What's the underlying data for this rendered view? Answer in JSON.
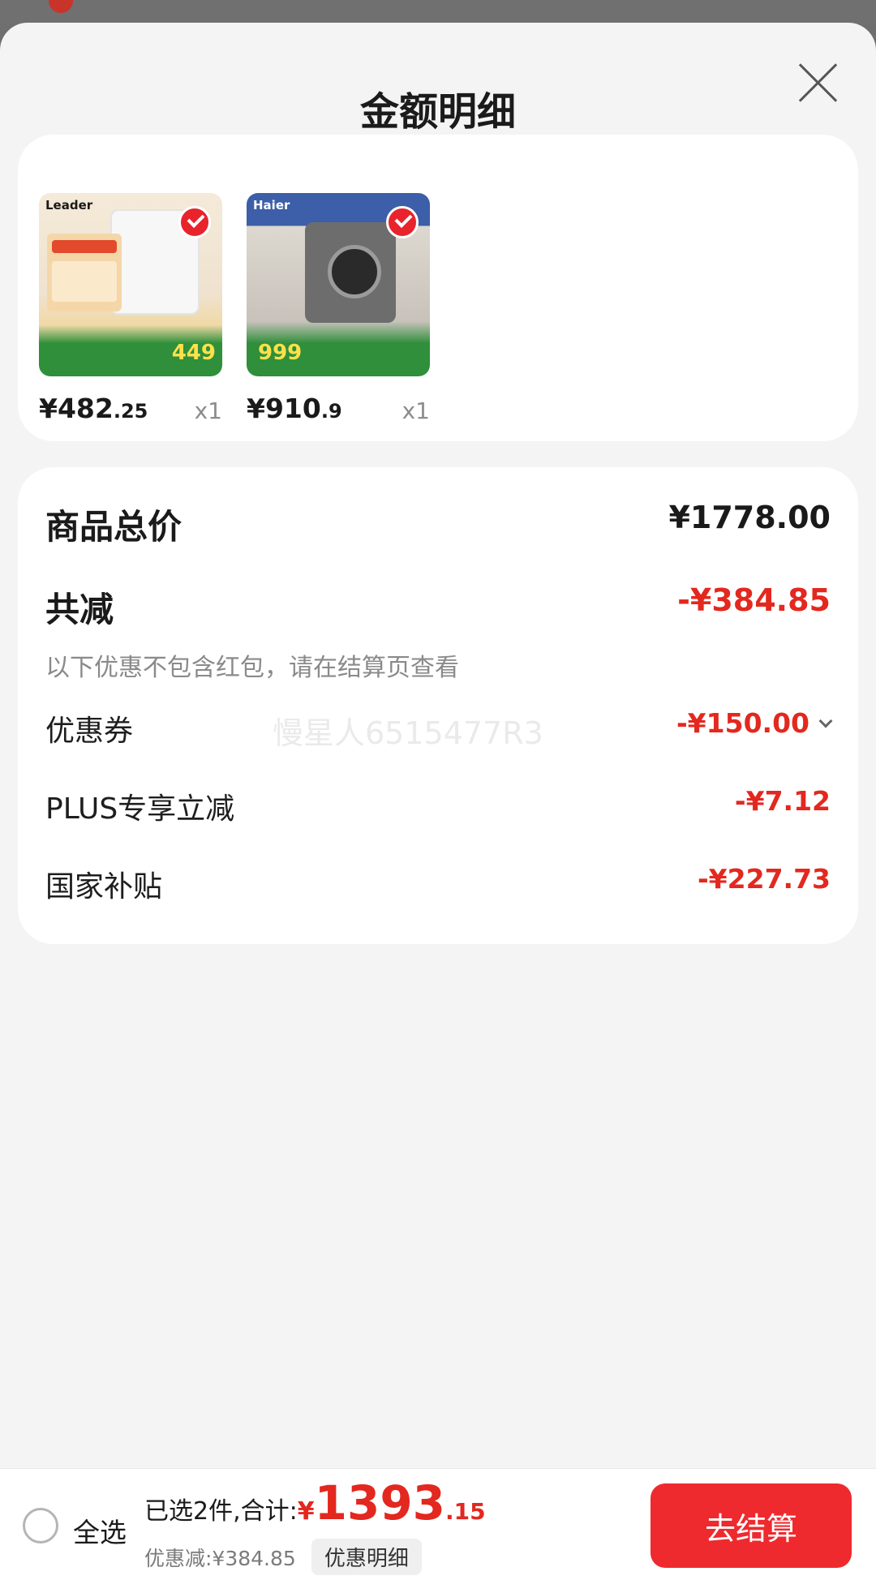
{
  "sheet": {
    "title": "金额明细"
  },
  "products": [
    {
      "brand": "Leader",
      "thumb_price": "449",
      "price_int": "¥482",
      "price_frac": ".25",
      "qty": "x1"
    },
    {
      "brand": "Haier",
      "thumb_price": "999",
      "price_int": "¥910",
      "price_frac": ".9",
      "qty": "x1"
    }
  ],
  "summary": {
    "total_label": "商品总价",
    "total_value": "¥1778.00",
    "reduce_label": "共减",
    "reduce_value": "-¥384.85",
    "note": "以下优惠不包含红包，请在结算页查看",
    "items": [
      {
        "label": "优惠券",
        "value": "-¥150.00"
      },
      {
        "label": "PLUS专享立减",
        "value": "-¥7.12"
      },
      {
        "label": "国家补贴",
        "value": "-¥227.73"
      }
    ]
  },
  "watermark": "慢星人6515477R3",
  "bottom": {
    "select_all": "全选",
    "selected_text": "已选2件,合计:",
    "yen": "¥",
    "total_int": "1393",
    "total_frac": ".15",
    "discount_text": "优惠减:¥384.85",
    "detail_button": "优惠明细",
    "checkout_button": "去结算"
  },
  "colors": {
    "accent": "#e3281f",
    "button": "#ee2a2f",
    "background": "#f4f4f4"
  }
}
